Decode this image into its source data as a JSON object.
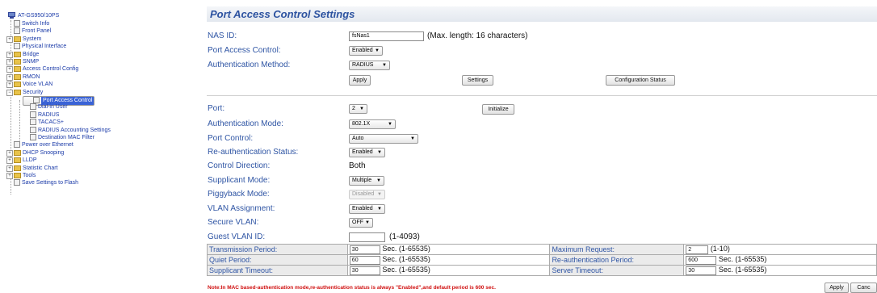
{
  "tree": {
    "root": "AT-GS950/10PS",
    "items": [
      {
        "label": "Switch Info",
        "type": "page"
      },
      {
        "label": "Front Panel",
        "type": "page"
      },
      {
        "label": "System",
        "type": "folder"
      },
      {
        "label": "Physical Interface",
        "type": "page"
      },
      {
        "label": "Bridge",
        "type": "folder"
      },
      {
        "label": "SNMP",
        "type": "folder"
      },
      {
        "label": "Access Control Config",
        "type": "folder"
      },
      {
        "label": "RMON",
        "type": "folder"
      },
      {
        "label": "Voice VLAN",
        "type": "folder"
      },
      {
        "label": "Security",
        "type": "folder-open"
      },
      {
        "label": "Port Access Control",
        "type": "page",
        "selected": true
      },
      {
        "label": "Dial-in User",
        "type": "page"
      },
      {
        "label": "RADIUS",
        "type": "page"
      },
      {
        "label": "TACACS+",
        "type": "page"
      },
      {
        "label": "RADIUS Accounting Settings",
        "type": "page"
      },
      {
        "label": "Destination MAC Filter",
        "type": "page"
      },
      {
        "label": "Power over Ethernet",
        "type": "page"
      },
      {
        "label": "DHCP Snooping",
        "type": "folder"
      },
      {
        "label": "LLDP",
        "type": "folder"
      },
      {
        "label": "Statistic Chart",
        "type": "folder"
      },
      {
        "label": "Tools",
        "type": "folder"
      },
      {
        "label": "Save Settings to Flash",
        "type": "page"
      }
    ]
  },
  "page": {
    "title": "Port Access Control Settings",
    "nas_id": {
      "label": "NAS ID:",
      "value": "fsNas1",
      "hint": "(Max. length: 16 characters)"
    },
    "pac": {
      "label": "Port Access Control:",
      "value": "Enabled"
    },
    "auth_method": {
      "label": "Authentication Method:",
      "value": "RADIUS"
    },
    "buttons": {
      "apply": "Apply",
      "settings": "Settings",
      "config_status": "Configuration Status",
      "initialize": "Initialize"
    },
    "port": {
      "label": "Port:",
      "value": "2"
    },
    "auth_mode": {
      "label": "Authentication Mode:",
      "value": "802.1X"
    },
    "port_control": {
      "label": "Port Control:",
      "value": "Auto"
    },
    "reauth_status": {
      "label": "Re-authentication Status:",
      "value": "Enabled"
    },
    "control_direction": {
      "label": "Control Direction:",
      "value": "Both"
    },
    "supplicant_mode": {
      "label": "Supplicant Mode:",
      "value": "Multiple"
    },
    "piggyback_mode": {
      "label": "Piggyback Mode:",
      "value": "Disabled"
    },
    "vlan_assignment": {
      "label": "VLAN Assignment:",
      "value": "Enabled"
    },
    "secure_vlan": {
      "label": "Secure VLAN:",
      "value": "OFF"
    },
    "guest_vlan": {
      "label": "Guest VLAN ID:",
      "value": "",
      "hint": "(1-4093)"
    },
    "timers": [
      {
        "label": "Transmission Period:",
        "value": "30",
        "unit": "Sec. (1-65535)",
        "label2": "Maximum Request:",
        "value2": "2",
        "unit2": "(1-10)"
      },
      {
        "label": "Quiet Period:",
        "value": "60",
        "unit": "Sec. (1-65535)",
        "label2": "Re-authentication Period:",
        "value2": "600",
        "unit2": "Sec. (1-65535)"
      },
      {
        "label": "Supplicant Timeout:",
        "value": "30",
        "unit": "Sec. (1-65535)",
        "label2": "Server Timeout:",
        "value2": "30",
        "unit2": "Sec. (1-65535)"
      }
    ],
    "note": "Note:In MAC based-authentication mode,re-authentication status is always \"Enabled\",and default period is 600 sec.",
    "bottom_apply": "Apply",
    "bottom_cancel": "Canc"
  }
}
